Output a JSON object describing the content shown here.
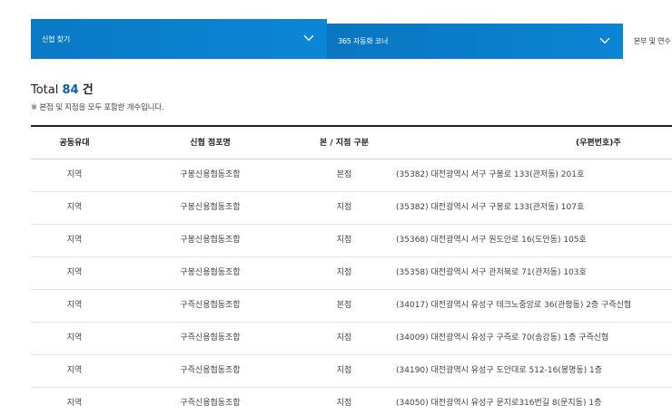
{
  "tabs": [
    {
      "label": "신협 찾기"
    },
    {
      "label": "365 자동화 코너"
    },
    {
      "label": "본부 및 연수"
    }
  ],
  "summary": {
    "total_prefix": "Total",
    "total_count": "84",
    "total_unit": "건",
    "note": "※ 본점 및 지점을 모두 포함한 개수입니다."
  },
  "table": {
    "headers": [
      "공동유대",
      "신협 점포명",
      "본 / 지점 구분",
      "(우편번호)주"
    ],
    "rows": [
      [
        "지역",
        "구봉신용협동조합",
        "본점",
        "(35382) 대전광역시 서구 구봉로 133(관저동) 201호"
      ],
      [
        "지역",
        "구봉신용협동조합",
        "지점",
        "(35382) 대전광역시 서구 구봉로 133(관저동) 107호"
      ],
      [
        "지역",
        "구봉신용협동조합",
        "지점",
        "(35368) 대전광역시 서구 원도안로 16(도안동) 105호"
      ],
      [
        "지역",
        "구봉신용협동조합",
        "지점",
        "(35358) 대전광역시 서구 관저북로 71(관저동) 103호"
      ],
      [
        "지역",
        "구즉신용협동조합",
        "본점",
        "(34017) 대전광역시 유성구 테크노중앙로 36(관평동) 2층 구즉신협"
      ],
      [
        "지역",
        "구즉신용협동조합",
        "지점",
        "(34009) 대전광역시 유성구 구즉로 70(송강동) 1층 구즉신협"
      ],
      [
        "지역",
        "구즉신용협동조합",
        "지점",
        "(34190) 대전광역시 유성구 도안대로 512-16(봉명동) 1층"
      ],
      [
        "지역",
        "구즉신용협동조합",
        "지점",
        "(34050) 대전광역시 유성구 문지로316번길 8(문지동) 1층"
      ]
    ]
  }
}
